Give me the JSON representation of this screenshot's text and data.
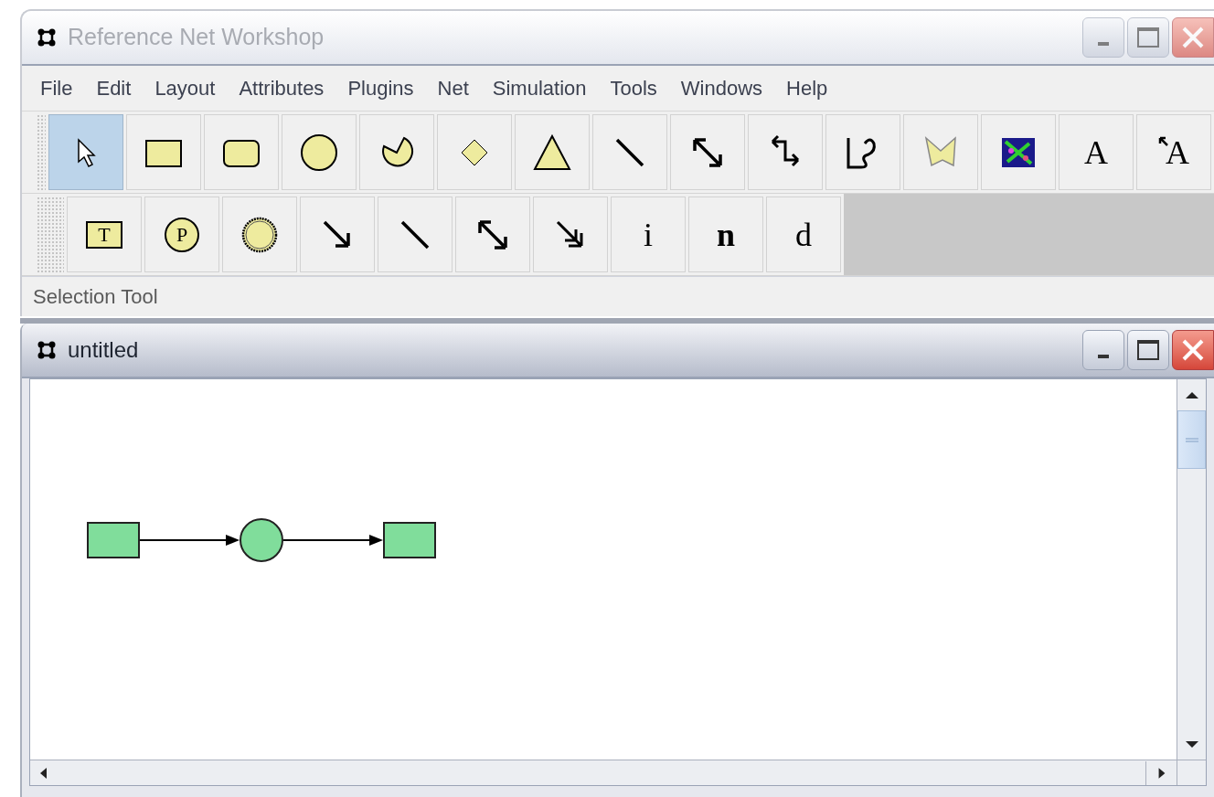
{
  "app_window": {
    "title": "Reference Net Workshop",
    "active": false,
    "menu": [
      "File",
      "Edit",
      "Layout",
      "Attributes",
      "Plugins",
      "Net",
      "Simulation",
      "Tools",
      "Windows",
      "Help"
    ],
    "toolbars": [
      [
        {
          "kind": "pointer",
          "selected": true
        },
        {
          "kind": "rectangle",
          "selected": false
        },
        {
          "kind": "roundrect",
          "selected": false
        },
        {
          "kind": "ellipse",
          "selected": false
        },
        {
          "kind": "pie",
          "selected": false
        },
        {
          "kind": "diamond",
          "selected": false
        },
        {
          "kind": "triangle",
          "selected": false
        },
        {
          "kind": "line",
          "selected": false
        },
        {
          "kind": "doublearrow",
          "selected": false
        },
        {
          "kind": "elbow",
          "selected": false
        },
        {
          "kind": "scribble",
          "selected": false
        },
        {
          "kind": "polygon",
          "selected": false
        },
        {
          "kind": "image",
          "selected": false
        },
        {
          "kind": "letter",
          "label": "A",
          "selected": false
        },
        {
          "kind": "linkedletter",
          "label": "A",
          "selected": false
        }
      ],
      [
        {
          "kind": "textbox",
          "label": "T",
          "selected": false
        },
        {
          "kind": "circleletter",
          "label": "P",
          "selected": false
        },
        {
          "kind": "ring",
          "selected": false
        },
        {
          "kind": "arrow",
          "selected": false
        },
        {
          "kind": "line",
          "selected": false
        },
        {
          "kind": "doublearrow",
          "selected": false
        },
        {
          "kind": "doublehead",
          "selected": false
        },
        {
          "kind": "letter",
          "label": "i",
          "selected": false
        },
        {
          "kind": "boldletter",
          "label": "n",
          "selected": false
        },
        {
          "kind": "letter",
          "label": "d",
          "selected": false
        }
      ]
    ],
    "status": "Selection Tool"
  },
  "drawing_window": {
    "title": "untitled",
    "active": true,
    "net": [
      {
        "kind": "transition"
      },
      {
        "kind": "arc"
      },
      {
        "kind": "place"
      },
      {
        "kind": "arc"
      },
      {
        "kind": "transition"
      }
    ]
  }
}
